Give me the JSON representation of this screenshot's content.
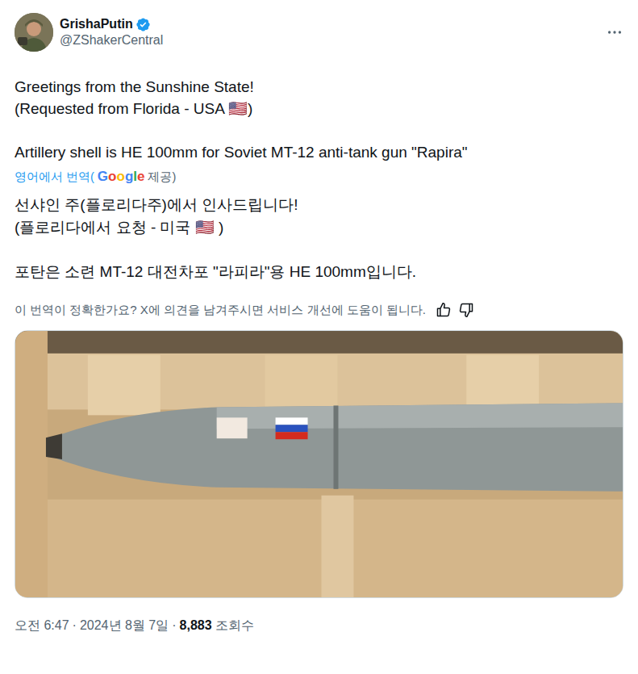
{
  "author": {
    "name": "GrishaPutin",
    "handle": "@ZShakerCentral",
    "verified": true
  },
  "post": {
    "paragraphs": [
      [
        "Greetings from the Sunshine State!",
        "(Requested from Florida - USA 🇺🇸)"
      ],
      [
        "Artillery shell is HE 100mm for Soviet MT-12 anti-tank gun \"Rapira\""
      ]
    ]
  },
  "translation_label": {
    "prefix": "영어에서 번역(",
    "brand": "Google",
    "suffix": " 제공)"
  },
  "translation": {
    "paragraphs": [
      [
        "선샤인 주(플로리다주)에서 인사드립니다!",
        "(플로리다에서 요청 - 미국 🇺🇸 )"
      ],
      [
        "포탄은 소련 MT-12 대전차포 \"라피라\"용 HE 100mm입니다."
      ]
    ]
  },
  "feedback": {
    "prompt": "이 번역이 정확한가요? X에 의견을 남겨주시면 서비스 개선에 도움이 됩니다."
  },
  "meta": {
    "time": "오전 6:47",
    "separator": "·",
    "date": "2024년 8월 7일",
    "views": "8,883",
    "views_label": "조회수"
  }
}
